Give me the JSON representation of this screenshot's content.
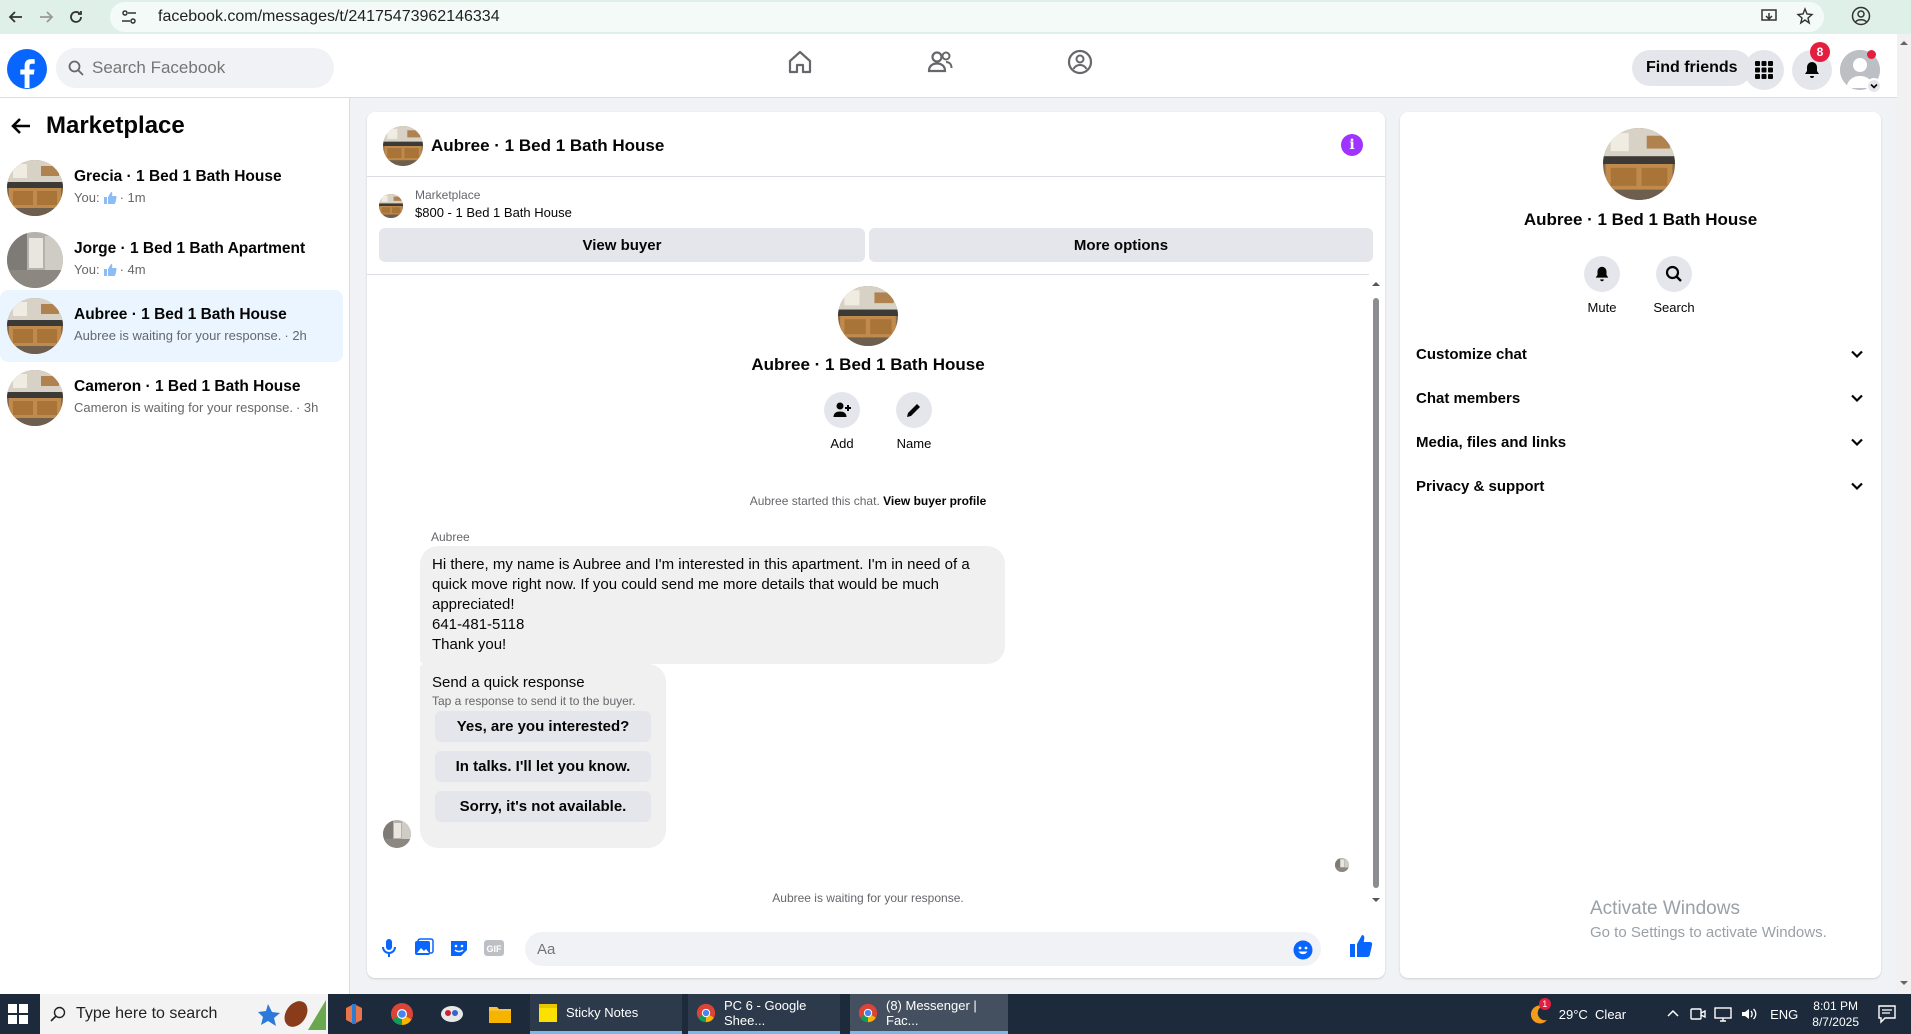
{
  "browser": {
    "url": "facebook.com/messages/t/24175473962146334"
  },
  "header": {
    "search_placeholder": "Search Facebook",
    "find_friends_label": "Find friends",
    "notification_count": "8"
  },
  "sidebar": {
    "title": "Marketplace",
    "conversations": [
      {
        "name": "Grecia · 1 Bed 1 Bath House",
        "prefix": "You:",
        "time": "· 1m",
        "has_like": true
      },
      {
        "name": "Jorge · 1 Bed 1 Bath Apartment",
        "prefix": "You:",
        "time": "· 4m",
        "has_like": true
      },
      {
        "name": "Aubree · 1 Bed 1 Bath House",
        "prefix": "Aubree is waiting for your response.",
        "time": "· 2h",
        "has_like": false,
        "active": true
      },
      {
        "name": "Cameron · 1 Bed 1 Bath House",
        "prefix": "Cameron is waiting for your response.",
        "time": "· 3h",
        "has_like": false
      }
    ]
  },
  "chat": {
    "title": "Aubree · 1 Bed 1 Bath House",
    "marketplace_label": "Marketplace",
    "listing": "$800 - 1 Bed 1 Bath House",
    "view_buyer_label": "View buyer",
    "more_options_label": "More options",
    "profile_name": "Aubree · 1 Bed 1 Bath House",
    "add_label": "Add",
    "name_label": "Name",
    "started_text": "Aubree started this chat.",
    "view_buyer_profile": "View buyer profile",
    "sender": "Aubree",
    "message_lines": [
      "Hi there, my name is Aubree and I'm interested in this apartment. I'm in need of a",
      "quick move right now. If you could send me more details that would be much",
      "appreciated!",
      "641-481-5118",
      "Thank you!"
    ],
    "quick_response_title": "Send a quick response",
    "quick_response_sub": "Tap a response to send it to the buyer.",
    "quick_responses": [
      "Yes, are you interested?",
      "In talks. I'll let you know.",
      "Sorry, it's not available."
    ],
    "waiting_text": "Aubree is waiting for your response.",
    "composer_placeholder": "Aa"
  },
  "info_panel": {
    "name": "Aubree · 1 Bed 1 Bath House",
    "mute_label": "Mute",
    "search_label": "Search",
    "sections": [
      "Customize chat",
      "Chat members",
      "Media, files and links",
      "Privacy & support"
    ]
  },
  "watermark": {
    "line1": "Activate Windows",
    "line2": "Go to Settings to activate Windows."
  },
  "taskbar": {
    "search_placeholder": "Type here to search",
    "apps": [
      "Sticky Notes",
      "PC 6 - Google Shee...",
      "(8) Messenger | Fac..."
    ],
    "weather": "29°C  Clear",
    "language": "ENG",
    "time": "8:01 PM",
    "date": "8/7/2025",
    "weather_badge": "1"
  },
  "colors": {
    "fb_blue": "#0866ff",
    "active_bg": "#ebf5ff",
    "info_purple": "#a033ff",
    "notif_red": "#e41e3f"
  }
}
